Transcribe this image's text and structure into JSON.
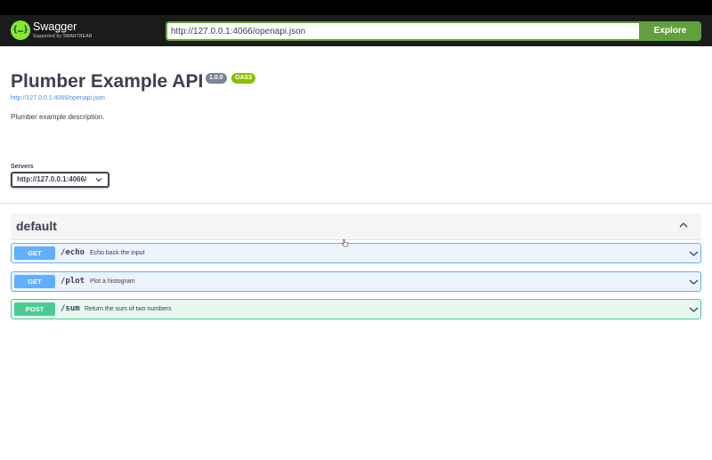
{
  "topbar": {
    "logo_name": "Swagger",
    "logo_sub": "Supported by SMARTBEAR",
    "url_value": "http://127.0.0.1:4066/openapi.json",
    "explore_label": "Explore",
    "accent_color": "#62a03f"
  },
  "info": {
    "title": "Plumber Example API",
    "version": "1.0.0",
    "oas_badge": "OAS3",
    "spec_link": "http://127.0.0.1:4066/openapi.json",
    "description": "Plumber example description."
  },
  "servers": {
    "label": "Servers",
    "selected": "http://127.0.0.1:4066/"
  },
  "tag": {
    "name": "default",
    "expanded": true
  },
  "operations": [
    {
      "method": "GET",
      "path": "/echo",
      "summary": "Echo back the input",
      "color": "#61affe"
    },
    {
      "method": "GET",
      "path": "/plot",
      "summary": "Plot a histogram",
      "color": "#61affe"
    },
    {
      "method": "POST",
      "path": "/sum",
      "summary": "Return the sum of two numbers",
      "color": "#49cc90"
    }
  ]
}
